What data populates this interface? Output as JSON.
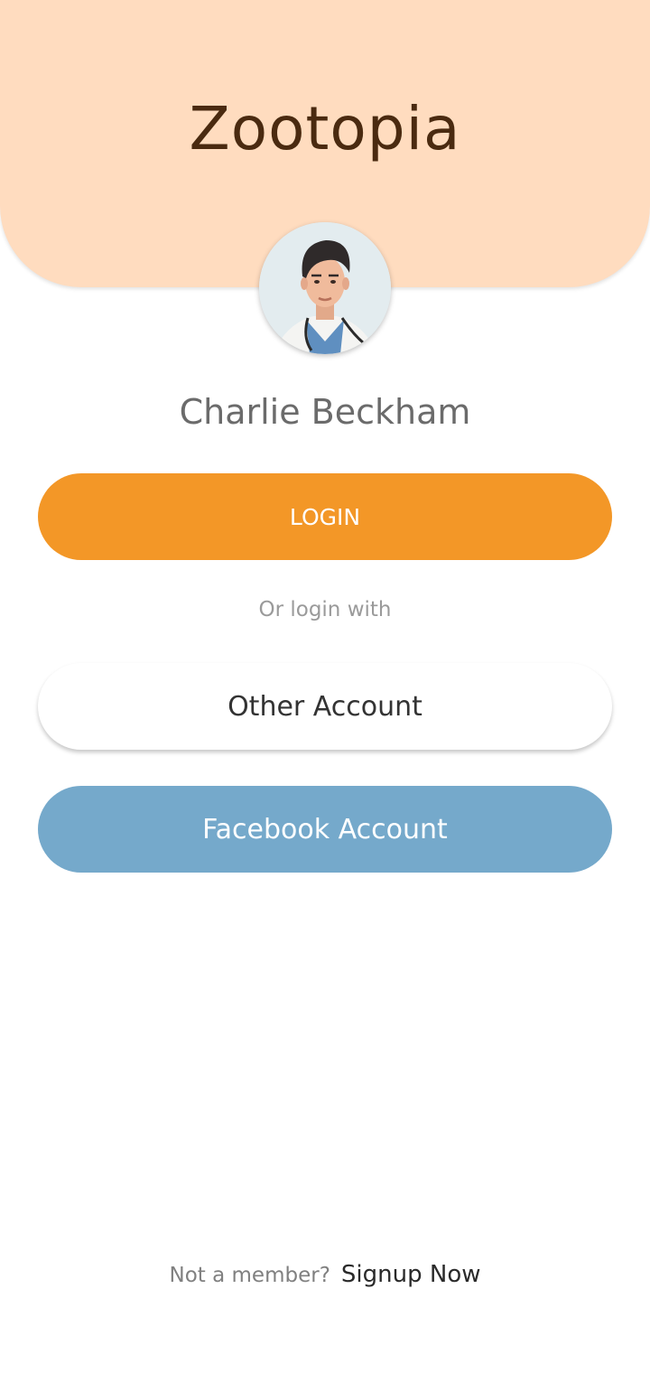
{
  "header": {
    "title": "Zootopia"
  },
  "profile": {
    "name": "Charlie Beckham"
  },
  "actions": {
    "login_label": "LOGIN",
    "divider_text": "Or login with",
    "other_account_label": "Other Account",
    "facebook_account_label": "Facebook Account"
  },
  "footer": {
    "note": "Not a member?",
    "signup_label": "Signup Now"
  },
  "colors": {
    "header_bg": "#ffdcbf",
    "title": "#4a2a10",
    "login_button": "#f39727",
    "facebook_button": "#75a9cb"
  }
}
